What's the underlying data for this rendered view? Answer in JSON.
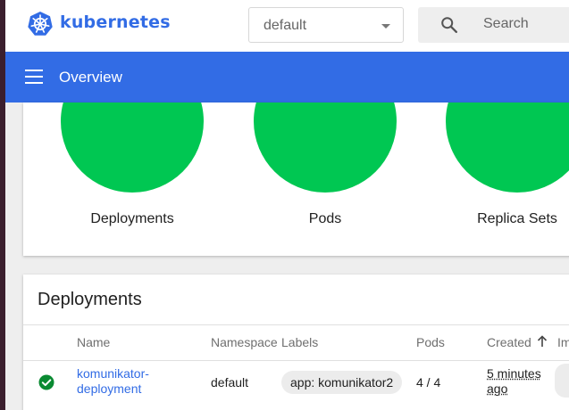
{
  "header": {
    "brand": "kubernetes",
    "namespace": {
      "selected": "default"
    },
    "search": {
      "placeholder": "Search"
    }
  },
  "appbar": {
    "title": "Overview"
  },
  "workload_status": {
    "items": [
      {
        "label": "Deployments",
        "state": "all running",
        "color": "#00c752"
      },
      {
        "label": "Pods",
        "state": "all running",
        "color": "#00c752"
      },
      {
        "label": "Replica Sets",
        "state": "all running",
        "color": "#00c752"
      }
    ]
  },
  "deployments": {
    "title": "Deployments",
    "columns": [
      "Name",
      "Namespace",
      "Labels",
      "Pods",
      "Created",
      "Im"
    ],
    "sort": {
      "column": "Created",
      "direction": "ascending"
    },
    "rows": [
      {
        "status": "running",
        "name_line1": "komunikator-",
        "name_line2": "deployment",
        "namespace": "default",
        "labels": "app: komunikator2",
        "pods": "4 / 4",
        "created_line1": "5 minutes",
        "created_line2": "ago"
      }
    ]
  },
  "colors": {
    "accent": "#326ce5",
    "success": "#00c752"
  }
}
